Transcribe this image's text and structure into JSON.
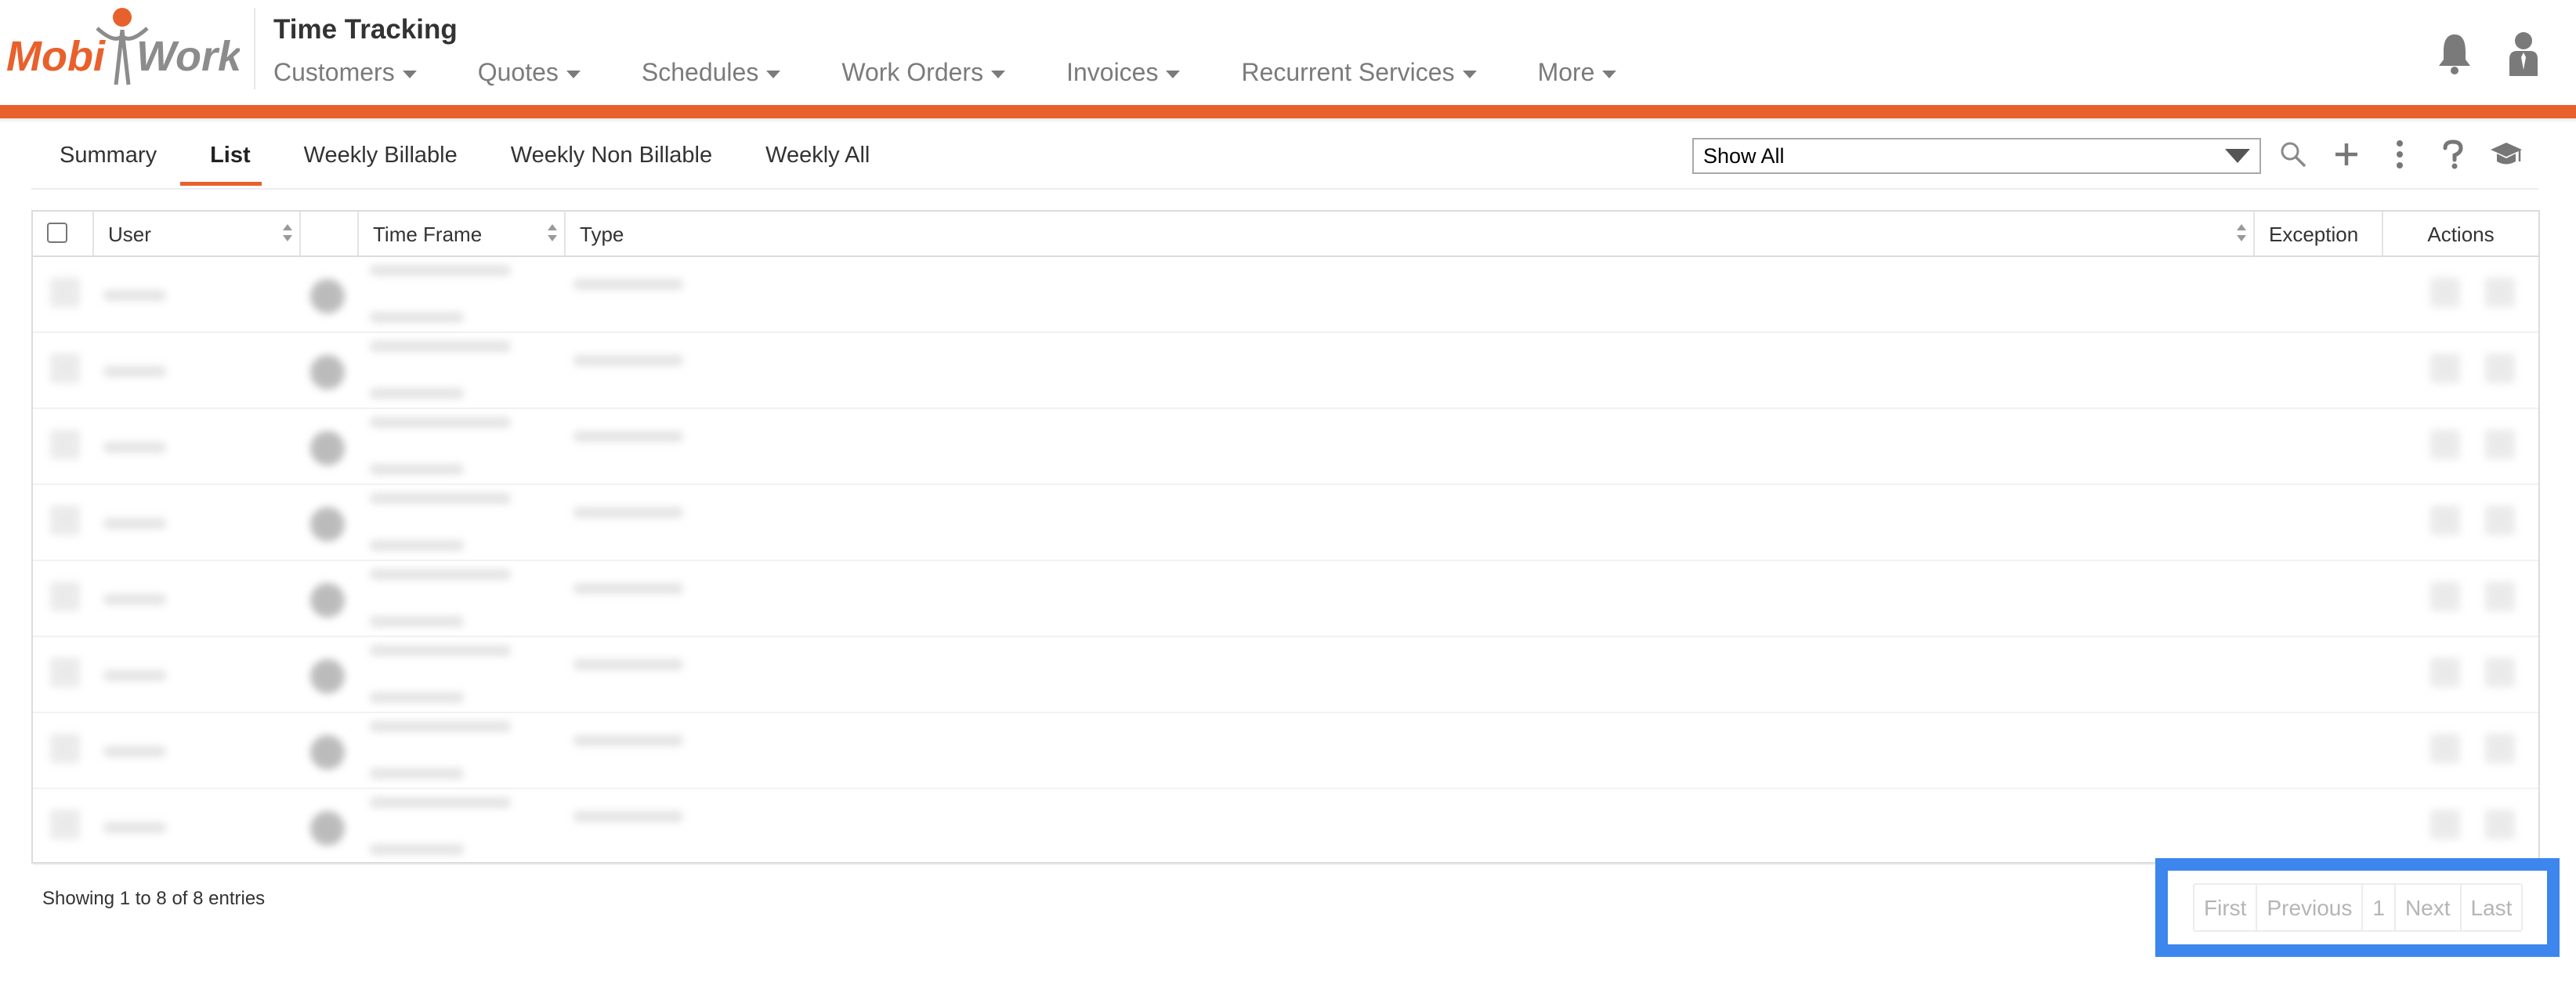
{
  "header": {
    "logo_left": "Mobi",
    "logo_right": "Work",
    "title": "Time Tracking",
    "nav": [
      {
        "label": "Customers"
      },
      {
        "label": "Quotes"
      },
      {
        "label": "Schedules"
      },
      {
        "label": "Work Orders"
      },
      {
        "label": "Invoices"
      },
      {
        "label": "Recurrent Services"
      },
      {
        "label": "More"
      }
    ],
    "icons": [
      "bell-icon",
      "user-icon"
    ]
  },
  "colors": {
    "accent": "#e8612c",
    "highlight": "#3c86ee",
    "nav_text": "#7b7b7b"
  },
  "tabs": [
    {
      "label": "Summary",
      "active": false
    },
    {
      "label": "List",
      "active": true
    },
    {
      "label": "Weekly Billable",
      "active": false
    },
    {
      "label": "Weekly Non Billable",
      "active": false
    },
    {
      "label": "Weekly All",
      "active": false
    }
  ],
  "toolbar": {
    "filter_value": "Show All",
    "icons": [
      "search-icon",
      "plus-icon",
      "more-vertical-icon",
      "help-icon",
      "graduation-cap-icon"
    ]
  },
  "table": {
    "columns": [
      {
        "label": ""
      },
      {
        "label": "User"
      },
      {
        "label": ""
      },
      {
        "label": "Time Frame"
      },
      {
        "label": "Type"
      },
      {
        "label": "Exception"
      },
      {
        "label": "Actions"
      }
    ],
    "row_count": 8
  },
  "footer": {
    "entries_text": "Showing 1 to 8 of 8 entries",
    "pagination": {
      "first": "First",
      "previous": "Previous",
      "page": "1",
      "next": "Next",
      "last": "Last"
    }
  }
}
